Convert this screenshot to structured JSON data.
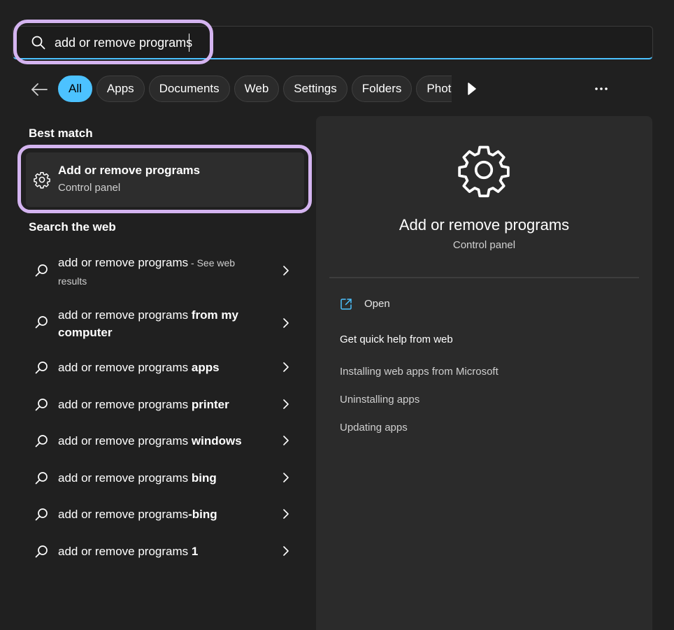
{
  "search": {
    "value": "add or remove programs",
    "placeholder": ""
  },
  "filters": {
    "chips": [
      "All",
      "Apps",
      "Documents",
      "Web",
      "Settings",
      "Folders",
      "Photos"
    ],
    "active": "All"
  },
  "best_match": {
    "heading": "Best match",
    "title": "Add or remove programs",
    "subtitle": "Control panel",
    "icon": "gear-icon"
  },
  "web": {
    "heading": "Search the web",
    "items": [
      {
        "prefix": "add or remove programs",
        "bold": "",
        "suffix": " - See web results"
      },
      {
        "prefix": "add or remove programs ",
        "bold": "from my computer",
        "suffix": ""
      },
      {
        "prefix": "add or remove programs ",
        "bold": "apps",
        "suffix": ""
      },
      {
        "prefix": "add or remove programs ",
        "bold": "printer",
        "suffix": ""
      },
      {
        "prefix": "add or remove programs ",
        "bold": "windows",
        "suffix": ""
      },
      {
        "prefix": "add or remove programs ",
        "bold": "bing",
        "suffix": ""
      },
      {
        "prefix": "add or remove programs",
        "bold": "-bing",
        "suffix": ""
      },
      {
        "prefix": "add or remove programs ",
        "bold": "1",
        "suffix": ""
      }
    ]
  },
  "detail": {
    "title": "Add or remove programs",
    "subtitle": "Control panel",
    "open_label": "Open",
    "help_heading": "Get quick help from web",
    "help_links": [
      "Installing web apps from Microsoft",
      "Uninstalling apps",
      "Updating apps"
    ]
  },
  "colors": {
    "accent": "#4cc2ff",
    "highlight": "#d4b4f0",
    "background": "#202020",
    "panel": "#2b2b2b"
  }
}
